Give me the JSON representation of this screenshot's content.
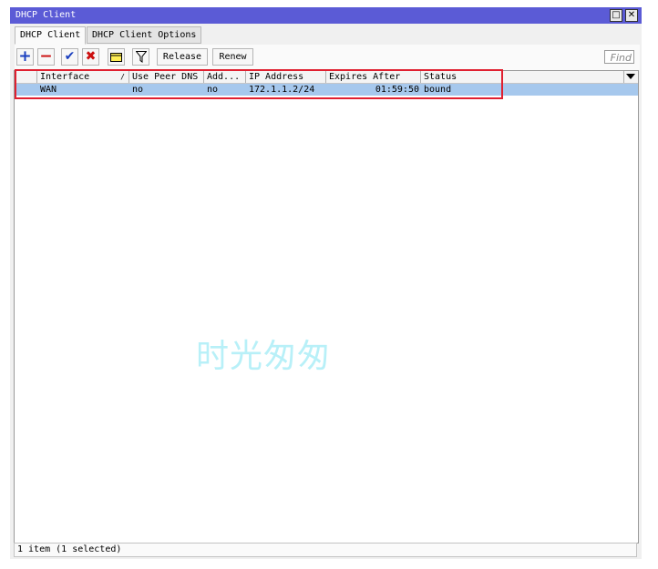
{
  "window": {
    "title": "DHCP Client"
  },
  "tabs": [
    {
      "label": "DHCP Client",
      "active": true
    },
    {
      "label": "DHCP Client Options",
      "active": false
    }
  ],
  "toolbar": {
    "add_icon": "plus-icon",
    "remove_icon": "minus-icon",
    "enable_icon": "check-icon",
    "disable_icon": "x-icon",
    "comment_icon": "note-icon",
    "filter_icon": "filter-funnel-icon",
    "release_label": "Release",
    "renew_label": "Renew",
    "find_placeholder": "Find"
  },
  "table": {
    "columns": [
      "Interface",
      "Use Peer DNS",
      "Add...",
      "IP Address",
      "Expires After",
      "Status"
    ],
    "sort_indicator": "/",
    "rows": [
      {
        "interface": "WAN",
        "use_peer_dns": "no",
        "add": "no",
        "ip_address": "172.1.1.2/24",
        "expires_after": "01:59:50",
        "status": "bound",
        "selected": true
      }
    ]
  },
  "statusbar": {
    "text": "1 item (1 selected)"
  },
  "watermark": "时光匆匆",
  "colors": {
    "titlebar": "#5b5bd6",
    "selection": "#a6c8ed",
    "highlight_box": "#e02030",
    "add_icon": "#1a3fbf",
    "remove_icon": "#cc1010"
  }
}
